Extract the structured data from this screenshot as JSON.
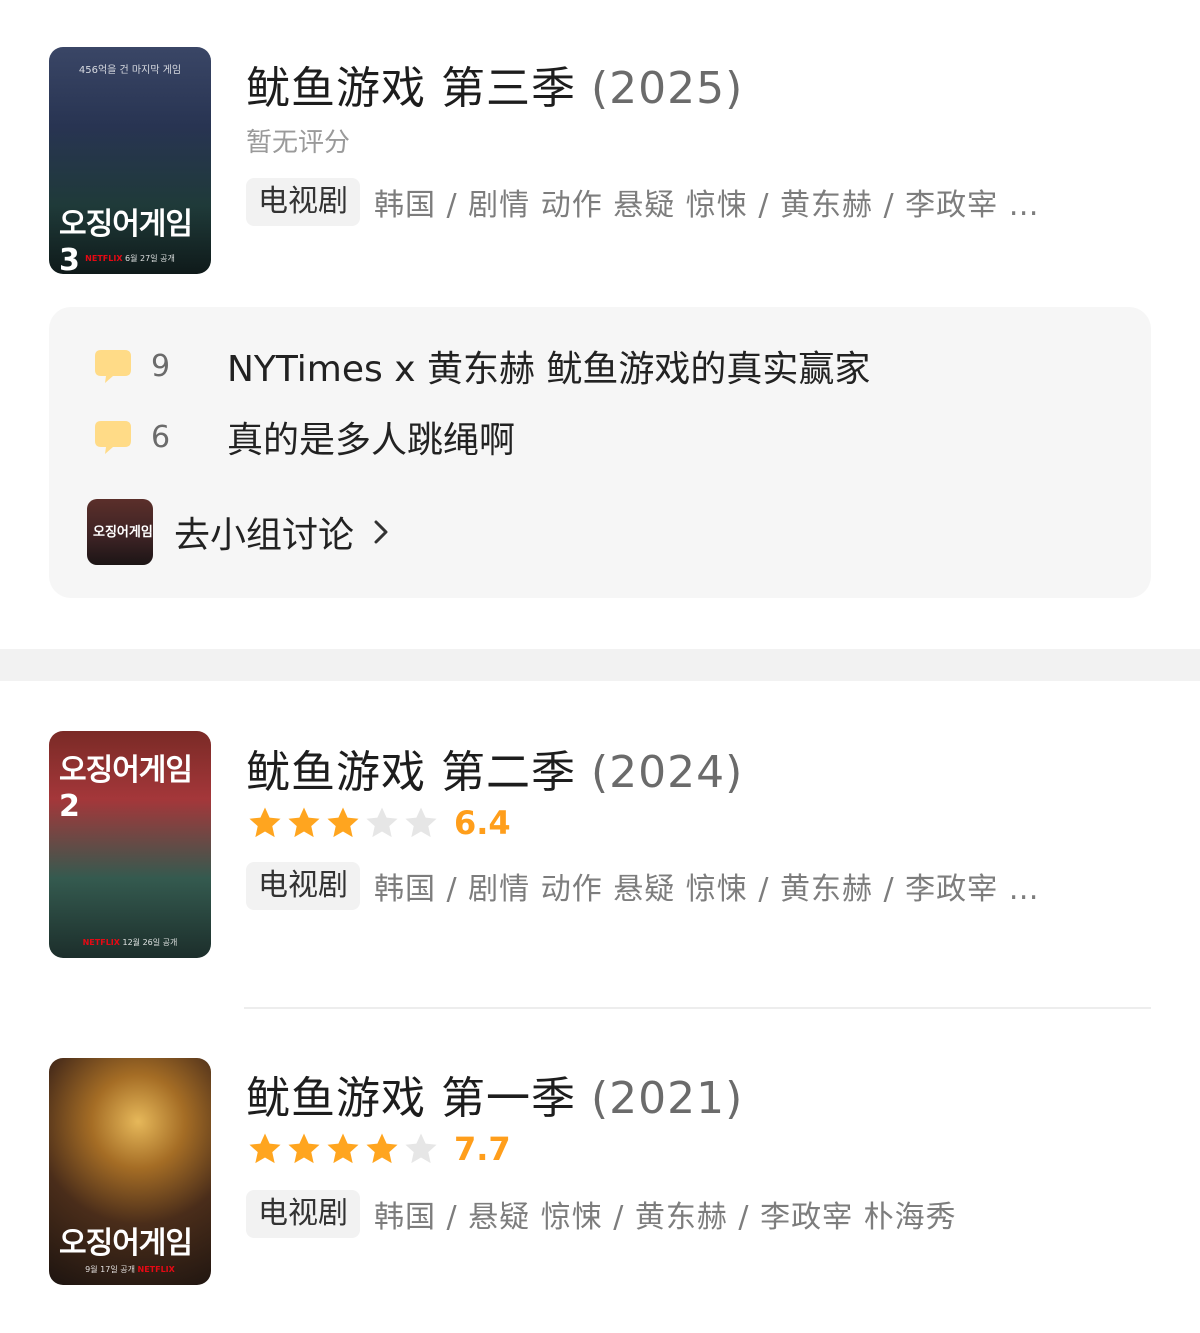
{
  "top_item": {
    "title": "鱿鱼游戏 第三季",
    "year": "(2025)",
    "rating_text": "暂无评分",
    "type_chip": "电视剧",
    "meta": "韩国 / 剧情 动作 悬疑 惊悚 / 黄东赫 / 李政宰 …",
    "poster": {
      "top_tag": "456억을 건 마지막 게임",
      "kr_title": "오징어게임3",
      "foot_platform": "NETFLIX",
      "foot_date": "6월 27일 공개"
    }
  },
  "group": {
    "posts": [
      {
        "count": "9",
        "title": "NYTimes x 黄东赫 鱿鱼游戏的真实赢家",
        "icon": "comment-bubble-icon"
      },
      {
        "count": "6",
        "title": "真的是多人跳绳啊",
        "icon": "comment-bubble-icon"
      }
    ],
    "link_label": "去小组讨论",
    "group_icon_text": "오징어게임"
  },
  "items": [
    {
      "title": "鱿鱼游戏 第二季",
      "year": "(2024)",
      "stars": 3,
      "score": "6.4",
      "type_chip": "电视剧",
      "meta": "韩国 / 剧情 动作 悬疑 惊悚 / 黄东赫 / 李政宰 …",
      "poster": {
        "kr_title": "오징어게임2",
        "foot_platform": "NETFLIX",
        "foot_date": "12월 26일 공개"
      }
    },
    {
      "title": "鱿鱼游戏 第一季",
      "year": "(2021)",
      "stars": 4,
      "score": "7.7",
      "type_chip": "电视剧",
      "meta": "韩国 / 悬疑 惊悚 / 黄东赫 / 李政宰 朴海秀",
      "poster": {
        "kr_title": "오징어게임",
        "foot_platform": "NETFLIX",
        "foot_date": "9월 17일 공개"
      }
    }
  ],
  "colors": {
    "star_filled": "#ffa51f",
    "star_empty": "#e6e6e6",
    "score": "#ff9e1b",
    "bubble": "#ffdb87"
  }
}
